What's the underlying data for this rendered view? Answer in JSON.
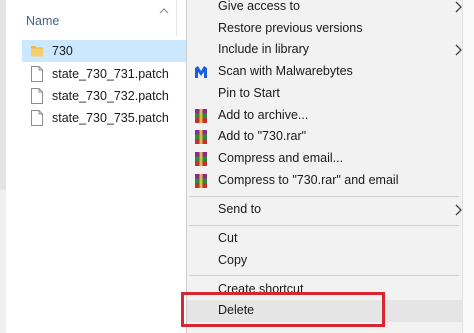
{
  "explorer": {
    "column_header": "Name",
    "items": [
      {
        "name": "730",
        "type": "folder",
        "selected": true
      },
      {
        "name": "state_730_731.patch",
        "type": "file"
      },
      {
        "name": "state_730_732.patch",
        "type": "file"
      },
      {
        "name": "state_730_735.patch",
        "type": "file"
      }
    ]
  },
  "context_menu": {
    "items": [
      {
        "label": "Give access to",
        "icon": "none",
        "submenu": true
      },
      {
        "label": "Restore previous versions",
        "icon": "none"
      },
      {
        "label": "Include in library",
        "icon": "none",
        "submenu": true
      },
      {
        "label": "Scan with Malwarebytes",
        "icon": "malwarebytes-icon"
      },
      {
        "label": "Pin to Start",
        "icon": "none"
      },
      {
        "label": "Add to archive...",
        "icon": "winrar-icon"
      },
      {
        "label": "Add to \"730.rar\"",
        "icon": "winrar-icon"
      },
      {
        "label": "Compress and email...",
        "icon": "winrar-icon"
      },
      {
        "label": "Compress to \"730.rar\" and email",
        "icon": "winrar-icon"
      },
      {
        "label": "Send to",
        "icon": "none",
        "submenu": true
      },
      {
        "label": "Cut",
        "icon": "none"
      },
      {
        "label": "Copy",
        "icon": "none"
      },
      {
        "label": "Create shortcut",
        "icon": "none"
      },
      {
        "label": "Delete",
        "icon": "none",
        "highlighted": true
      }
    ]
  },
  "colors": {
    "selection": "#cce8ff",
    "menu_background": "#f2f2f2",
    "highlight_border": "#d9262f",
    "header_text": "#4a6485"
  }
}
